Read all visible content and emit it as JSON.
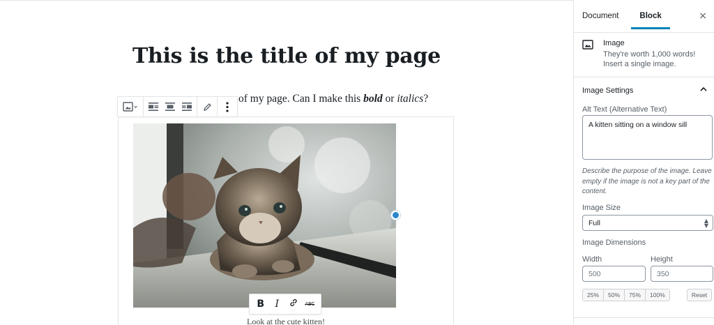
{
  "editor": {
    "page_title": "This is the title of my page",
    "paragraph": {
      "before": "of my page. Can I make this ",
      "bold": "bold",
      "middle": " or ",
      "italic": "italics",
      "after": "?"
    },
    "block_toolbar": {
      "buttons": [
        "image-block-type-icon",
        "align-left-icon",
        "align-center-icon",
        "align-right-icon",
        "pencil-edit-icon",
        "more-options-icon"
      ]
    },
    "image": {
      "alt": "A kitten sitting on a window sill"
    },
    "format_toolbar": {
      "bold": "B",
      "italic": "I",
      "link_icon": "link-icon",
      "strikethrough": "ABC"
    },
    "caption": "Look at the cute kitten!"
  },
  "sidebar": {
    "tabs": [
      {
        "label": "Document",
        "active": false
      },
      {
        "label": "Block",
        "active": true
      }
    ],
    "close_symbol": "×",
    "block_card": {
      "icon": "image-icon",
      "title": "Image",
      "description": "They're worth 1,000 words! Insert a single image."
    },
    "image_settings": {
      "title": "Image Settings",
      "expanded": true,
      "alt_label": "Alt Text (Alternative Text)",
      "alt_value": "A kitten sitting on a window sill",
      "help_text": "Describe the purpose of the image. Leave empty if the image is not a key part of the content.",
      "size_label": "Image Size",
      "size_value": "Full",
      "dimensions_label": "Image Dimensions",
      "width_label": "Width",
      "width_value": "500",
      "height_label": "Height",
      "height_value": "350",
      "percent_buttons": [
        "25%",
        "50%",
        "75%",
        "100%"
      ],
      "reset_label": "Reset"
    }
  },
  "colors": {
    "accent": "#0085ba",
    "resize_handle": "#2b85ca",
    "border": "#e2e4e7"
  }
}
